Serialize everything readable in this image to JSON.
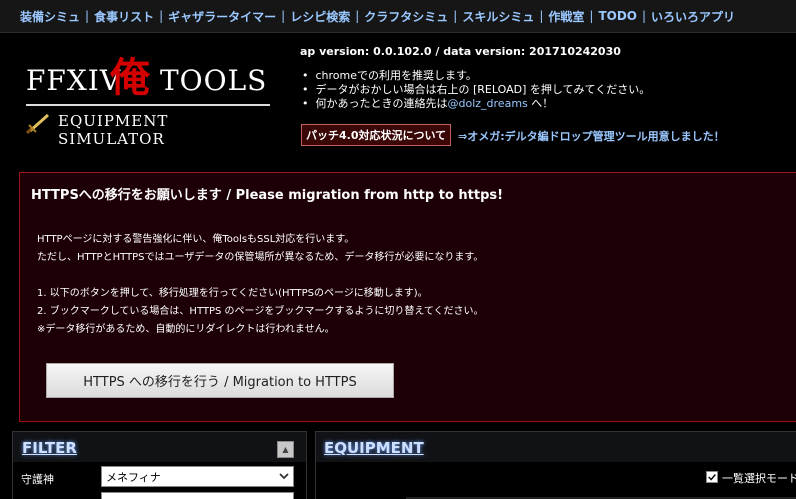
{
  "nav": {
    "items": [
      "装備シミュ",
      "食事リスト",
      "ギャザラータイマー",
      "レシピ検索",
      "クラフタシミュ",
      "スキルシミュ",
      "作戦室",
      "TODO",
      "いろいろアプリ"
    ],
    "separator": "|"
  },
  "logo": {
    "brand_left": "FFXIV",
    "brand_kanji": "俺",
    "brand_right": "TOOLS",
    "subtitle": "EQUIPMENT SIMULATOR"
  },
  "header": {
    "version": "ap version: 0.0.102.0 / data version: 201710242030",
    "notes": [
      "chromeでの利用を推奨します。",
      "データがおかしい場合は右上の [RELOAD] を押してみてください。",
      "何かあったときの連絡先は"
    ],
    "contact": "@dolz_dreams",
    "contact_suffix": " へ！",
    "patch_button": "パッチ4.0対応状況について",
    "omega_link": "⇒オメガ:デルタ編ドロップ管理ツール用意しました！"
  },
  "migration": {
    "title": "HTTPSへの移行をお願いします / Please migration from http to https!",
    "lines": [
      "HTTPページに対する警告強化に伴い、俺ToolsもSSL対応を行います。",
      "ただし、HTTPとHTTPSではユーザデータの保管場所が異なるため、データ移行が必要になります。",
      "",
      "1. 以下のボタンを押して、移行処理を行ってください(HTTPSのページに移動します)。",
      "2. ブックマークしている場合は、HTTPS のページをブックマークするように切り替えてください。",
      "※データ移行があるため、自動的にリダイレクトは行われません。"
    ],
    "button": "HTTPS への移行を行う / Migration to HTTPS"
  },
  "filter": {
    "title": "FILTER",
    "collapse_icon": "▲",
    "guardian_label": "守護神",
    "guardian_value": "メネフィナ"
  },
  "equipment": {
    "title": "EQUIPMENT",
    "list_select_label": "一覧選択モード"
  },
  "colors": {
    "link": "#9ac8ff",
    "migration_border": "#a01018",
    "kanji": "#d40000"
  }
}
